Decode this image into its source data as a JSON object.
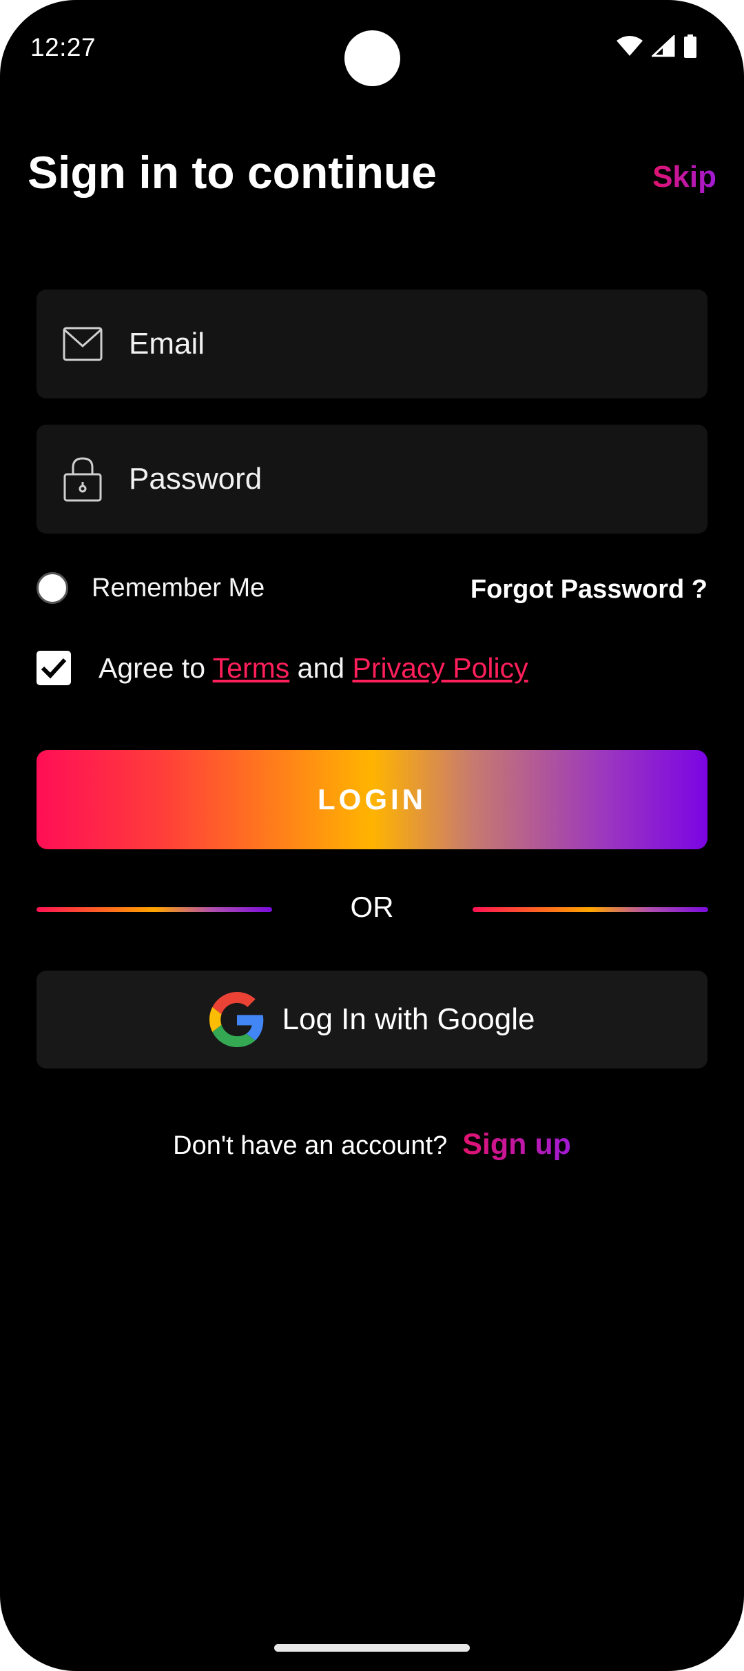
{
  "status_bar": {
    "time": "12:27",
    "icons": [
      "wifi-icon",
      "signal-icon",
      "battery-icon"
    ]
  },
  "header": {
    "title": "Sign in to continue",
    "skip_label": "Skip"
  },
  "form": {
    "email_placeholder": "Email",
    "email_icon": "mail-icon",
    "password_placeholder": "Password",
    "password_icon": "lock-icon",
    "remember_label": "Remember Me",
    "remember_checked": false,
    "forgot_label": "Forgot Password ?",
    "agree": {
      "prefix": "Agree to ",
      "terms": "Terms",
      "middle": " and ",
      "privacy": "Privacy Policy",
      "checked": true
    },
    "login_label": "LOGIN"
  },
  "divider": {
    "label": "OR"
  },
  "social": {
    "google_label": "Log In with Google",
    "google_icon": "google-icon"
  },
  "footer": {
    "question": "Don't have an account?",
    "signup_label": "Sign up"
  },
  "colors": {
    "background": "#000000",
    "field_bg": "#141414",
    "accent_pink": "#e2136e",
    "accent_purple": "#a11bd6",
    "link_red": "#ff1f5a"
  }
}
